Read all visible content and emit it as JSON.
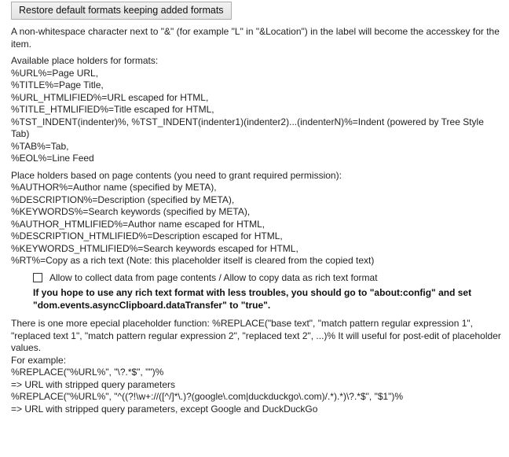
{
  "restore_button_label": "Restore default formats keeping added formats",
  "accesskey_note": "A non-whitespace character next to \"&\" (for example \"L\" in \"&Location\") in the label will become the accesskey for the item.",
  "placeholders": {
    "heading": "Available place holders for formats:",
    "items": [
      "%URL%=Page URL,",
      "%TITLE%=Page Title,",
      "%URL_HTMLIFIED%=URL escaped for HTML,",
      "%TITLE_HTMLIFIED%=Title escaped for HTML,",
      "%TST_INDENT(indenter)%, %TST_INDENT(indenter1)(indenter2)...(indenterN)%=Indent (powered by Tree Style Tab)",
      "%TAB%=Tab,",
      "%EOL%=Line Feed"
    ]
  },
  "content_placeholders": {
    "heading": "Place holders based on page contents (you need to grant required permission):",
    "items": [
      "%AUTHOR%=Author name (specified by META),",
      "%DESCRIPTION%=Description (specified by META),",
      "%KEYWORDS%=Search keywords (specified by META),",
      "%AUTHOR_HTMLIFIED%=Author name escaped for HTML,",
      "%DESCRIPTION_HTMLIFIED%=Description escaped for HTML,",
      "%KEYWORDS_HTMLIFIED%=Search keywords escaped for HTML,",
      "%RT%=Copy as a rich text (Note: this placeholder itself is cleared from the copied text)"
    ]
  },
  "checkbox": {
    "label": "Allow to collect data from page contents / Allow to copy data as rich text format",
    "checked": false
  },
  "warning_text": "If you hope to use any rich text format with less troubles, you should go to \"about:config\" and set \"dom.events.asyncClipboard.dataTransfer\" to \"true\".",
  "replace_info": {
    "description": "There is one more epecial placeholder function: %REPLACE(\"base text\", \"match pattern regular expression 1\", \"replaced text 1\", \"match pattern regular expression 2\", \"replaced text 2\", ...)% It will useful for post-edit of placeholder values.",
    "example_heading": "For example:",
    "examples": [
      "%REPLACE(\"%URL%\", \"\\?.*$\", \"\")%",
      " => URL with stripped query parameters",
      "%REPLACE(\"%URL%\", \"^((?!\\w+://([^/]*\\.)?(google\\.com|duckduckgo\\.com)/.*).*)\\?.*$\", \"$1\")%",
      " => URL with stripped query parameters, except Google and DuckDuckGo"
    ]
  }
}
